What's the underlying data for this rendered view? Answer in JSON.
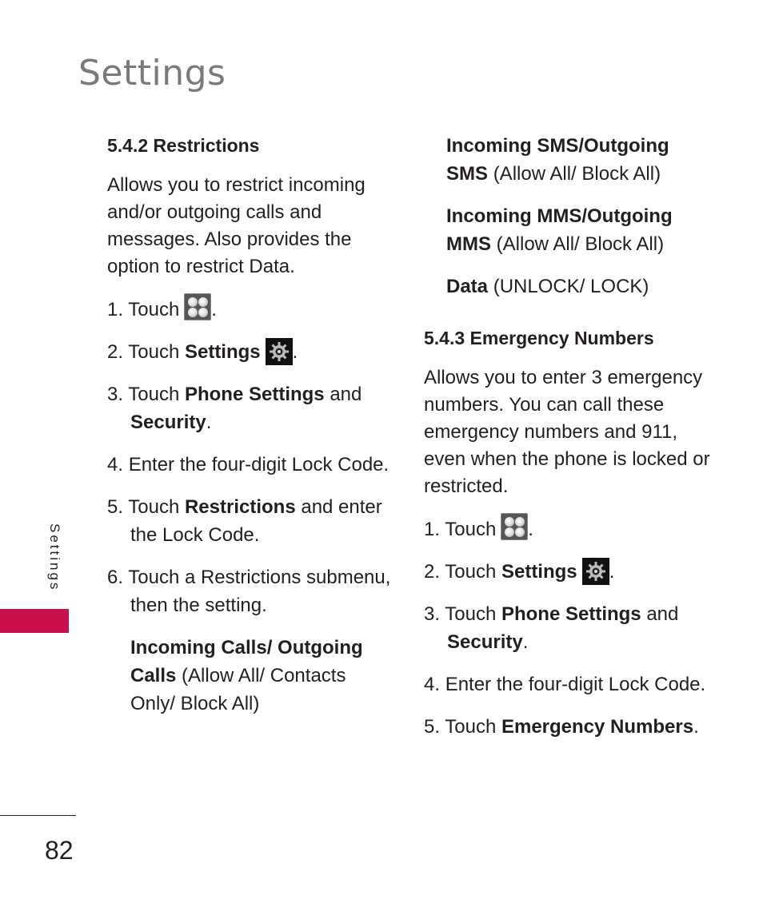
{
  "page": {
    "title": "Settings",
    "side_tab": "Settings",
    "page_number": "82",
    "accent_color": "#c8104d"
  },
  "left_column": {
    "heading": "5.4.2 Restrictions",
    "intro": "Allows you to restrict incoming and/or outgoing calls and messages. Also provides the option to restrict Data.",
    "steps": [
      {
        "num": "1.",
        "pre": "Touch",
        "bold": "",
        "post": "",
        "icon": "apps-grid-icon"
      },
      {
        "num": "2.",
        "pre": "Touch",
        "bold": "Settings",
        "post": "",
        "icon": "settings-gear-icon"
      },
      {
        "num": "3.",
        "pre": "Touch",
        "bold": "Phone Settings",
        "mid": "and",
        "bold2": "Security",
        "post": "."
      },
      {
        "num": "4.",
        "pre": "Enter the four-digit Lock Code.",
        "bold": "",
        "post": ""
      },
      {
        "num": "5.",
        "pre": "Touch",
        "bold": "Restrictions",
        "post": "and enter the Lock Code."
      },
      {
        "num": "6.",
        "pre": "Touch a Restrictions submenu, then the setting.",
        "bold": "",
        "post": ""
      }
    ],
    "options": [
      {
        "bold": "Incoming Calls/ Outgoing Calls",
        "values": "(Allow All/ Contacts Only/ Block All)"
      }
    ]
  },
  "right_column": {
    "options": [
      {
        "bold": "Incoming SMS/Outgoing SMS",
        "values": "(Allow All/ Block All)"
      },
      {
        "bold": "Incoming MMS/Outgoing MMS",
        "values": "(Allow All/ Block All)"
      },
      {
        "bold": "Data",
        "values": "(UNLOCK/ LOCK)"
      }
    ],
    "heading": "5.4.3 Emergency Numbers",
    "intro": "Allows you to enter 3 emergency numbers. You can call these emergency numbers and 911, even when the phone is locked or restricted.",
    "steps": [
      {
        "num": "1.",
        "pre": "Touch",
        "icon": "apps-grid-icon"
      },
      {
        "num": "2.",
        "pre": "Touch",
        "bold": "Settings",
        "icon": "settings-gear-icon"
      },
      {
        "num": "3.",
        "pre": "Touch",
        "bold": "Phone Settings",
        "mid": "and",
        "bold2": "Security",
        "post": "."
      },
      {
        "num": "4.",
        "pre": "Enter the four-digit Lock Code."
      },
      {
        "num": "5.",
        "pre": "Touch",
        "bold": "Emergency Numbers",
        "post": "."
      }
    ]
  }
}
